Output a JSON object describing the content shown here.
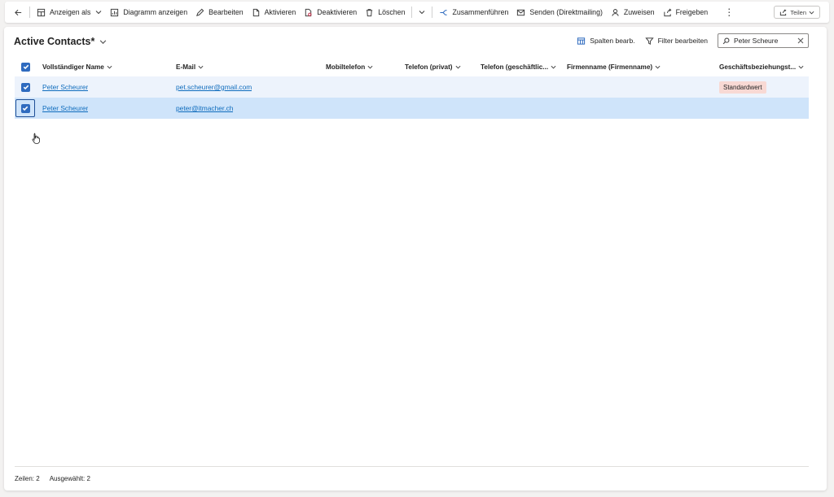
{
  "commandbar": {
    "items": [
      {
        "label": "Anzeigen als",
        "icon": "layout-icon"
      },
      {
        "label": "Diagramm anzeigen",
        "icon": "chart-icon"
      },
      {
        "label": "Bearbeiten",
        "icon": "pencil-icon"
      },
      {
        "label": "Aktivieren",
        "icon": "document-icon"
      },
      {
        "label": "Deaktivieren",
        "icon": "document-deactivate-icon"
      },
      {
        "label": "Löschen",
        "icon": "trash-icon"
      },
      {
        "label": "Zusammenführen",
        "icon": "merge-icon"
      },
      {
        "label": "Senden (Direktmailing)",
        "icon": "mail-icon"
      },
      {
        "label": "Zuweisen",
        "icon": "person-icon"
      },
      {
        "label": "Freigeben",
        "icon": "share-icon"
      }
    ],
    "share_label": "Teilen"
  },
  "view": {
    "title": "Active Contacts*",
    "edit_columns_label": "Spalten bearb.",
    "edit_filters_label": "Filter bearbeiten",
    "search_value": "Peter Scheure"
  },
  "grid": {
    "columns": [
      "Vollständiger Name",
      "E-Mail",
      "Mobiltelefon",
      "Telefon (privat)",
      "Telefon (geschäftlic...",
      "Firmenname (Firmenname)",
      "Geschäftsbeziehungst..."
    ],
    "rows": [
      {
        "name": "Peter Scheurer",
        "email": "pet.scheurer@gmail.com",
        "mobile": "",
        "phone_private": "",
        "phone_business": "",
        "company": "",
        "relationship": "Standardwert",
        "selected": true
      },
      {
        "name": "Peter Scheurer",
        "email": "peter@itmacher.ch",
        "mobile": "",
        "phone_private": "",
        "phone_business": "",
        "company": "",
        "relationship": "",
        "selected": true
      }
    ]
  },
  "footer": {
    "rows_label": "Zeilen: 2",
    "selected_label": "Ausgewählt: 2"
  },
  "colors": {
    "accent": "#2f6bbf",
    "link": "#0f6cbd",
    "selected_row": "#cfe4fa",
    "tag_bg": "#f8d9d4"
  }
}
